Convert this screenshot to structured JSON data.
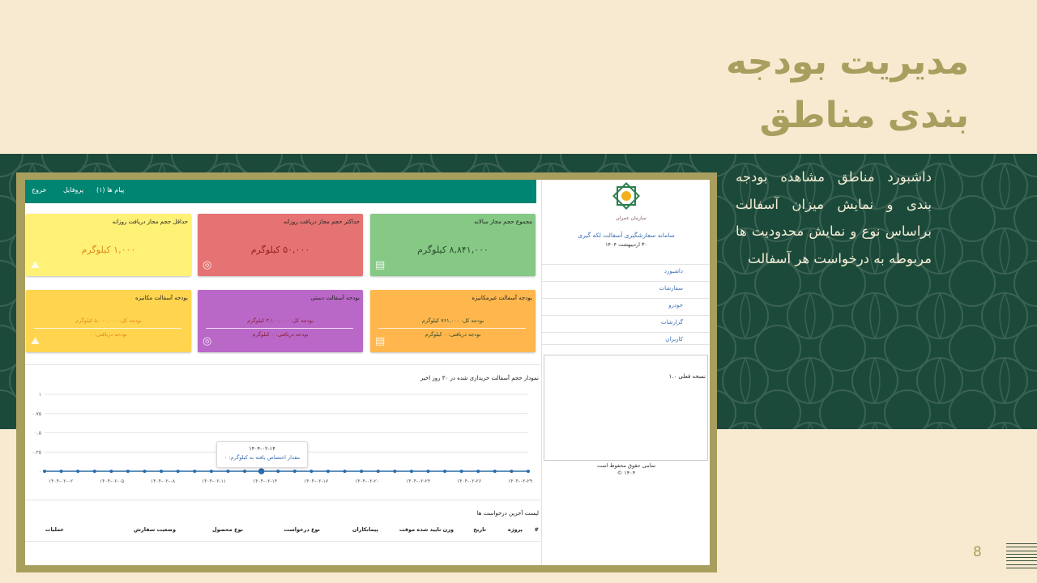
{
  "slide": {
    "title_line1": "مدیریت بودجه",
    "title_line2": "بندی مناطق",
    "description": "داشبورد مناطق مشاهده بودجه بندی و نمایش میزان آسفالت براساس نوع و نمایش محدودیت ها مربوطه به درخواست هر آسفالت",
    "page_number": "8",
    "colors": {
      "background": "#f7ead0",
      "band": "#1c4a3a",
      "title": "#a89e5e",
      "frame": "#a89e5e"
    }
  },
  "app": {
    "topbar": {
      "messages": "پیام ها (۱)",
      "profile": "پروفایل",
      "logout": "خروج",
      "color": "#008573"
    },
    "sidebar": {
      "logo_caption": "سازمان عمران",
      "system_name": "سامانه سفارشگیری آسفالت لکه گیری",
      "date": "۳۰ اردیبهشت ۱۴۰۴",
      "nav": [
        {
          "label": "داشبورد"
        },
        {
          "label": "سفارشات"
        },
        {
          "label": "خودرو"
        },
        {
          "label": "گزارشات"
        },
        {
          "label": "کاربران"
        }
      ],
      "version": "نسخه فعلی ۱.۰",
      "copyright": "تمامی حقوق محفوظ است",
      "copyright_year": "۱۴۰۴ ©"
    },
    "cards": [
      {
        "title": "مجموع حجم مجاز سالانه",
        "value": "۸,۸۴۱,۰۰۰ کیلوگرم",
        "color": "#85c985",
        "text_color": "#2e4a2e",
        "icon": "document-icon"
      },
      {
        "title": "حداکثر حجم مجاز دریافت روزانه",
        "value": "۵۰,۰۰۰ کیلوگرم",
        "color": "#e57373",
        "text_color": "#9a1f1f",
        "icon": "gauge-icon"
      },
      {
        "title": "حداقل حجم مجاز دریافت روزانه",
        "value": "۱,۰۰۰ کیلوگرم",
        "color": "#fff176",
        "text_color": "#e08a1e",
        "icon": "road-icon"
      },
      {
        "title": "بودجه آسفالت غیرمکانیزه",
        "line1": "بودجه کل: ۷۶۱,۰۰۰ کیلوگرم",
        "line2": "بودجه دریافتی: ۰ کیلوگرم",
        "color": "#ffb74d",
        "text_color": "#2e4a2e",
        "icon": "document-icon"
      },
      {
        "title": "بودجه آسفالت دستی",
        "line1": "بودجه کل: ۳,۱۰۰,۰۰۰ کیلوگرم",
        "line2": "بودجه دریافتی: ۰ کیلوگرم",
        "color": "#ba68c8",
        "text_color": "#8a1f3a",
        "icon": "gauge-icon"
      },
      {
        "title": "بودجه آسفالت مکانیزه",
        "line1": "بودجه کل: ۵,۰۰۰,۰۰۰ کیلوگرم",
        "line2": "بودجه دریافتی: ۰",
        "color": "#ffd54f",
        "text_color": "#e08a1e",
        "icon": "road-icon"
      }
    ],
    "table": {
      "title": "لیست آخرین درخواست ها",
      "headers": [
        "#",
        "پروژه",
        "تاریخ",
        "وزن تایید شده موقت",
        "پیمانکاران",
        "نوع درخواست",
        "نوع محصول",
        "وضعیت سفارش",
        "عملیات"
      ]
    },
    "tooltip": {
      "date": "۱۴۰۴-۰۲-۱۴",
      "label": "مقدار اختصاص یافته به کیلوگرم: ۰"
    }
  },
  "chart_data": {
    "type": "line",
    "title": "نمودار حجم آسفالت خریداری شده در ۳۰ روز اخیر",
    "ylim": [
      0,
      1
    ],
    "y_ticks": [
      "۰",
      "۰.۲۵",
      "۰.۵",
      "۰.۷۵",
      "۱"
    ],
    "x_tick_labels": [
      "۱۴۰۴-۰۲-۰۲",
      "۱۴۰۴-۰۲-۰۵",
      "۱۴۰۴-۰۲-۰۸",
      "۱۴۰۴-۰۲-۱۱",
      "۱۴۰۴-۰۲-۱۴",
      "۱۴۰۴-۰۲-۱۷",
      "۱۴۰۴-۰۲-۲۰",
      "۱۴۰۴-۰۲-۲۳",
      "۱۴۰۴-۰۲-۲۶",
      "۱۴۰۴-۰۲-۲۹"
    ],
    "x_range": [
      "۱۴۰۴-۰۲-۰۱",
      "۱۴۰۴-۰۳-۰۱"
    ],
    "values": [
      0,
      0,
      0,
      0,
      0,
      0,
      0,
      0,
      0,
      0,
      0,
      0,
      0,
      0,
      0,
      0,
      0,
      0,
      0,
      0,
      0,
      0,
      0,
      0,
      0,
      0,
      0,
      0,
      0,
      0
    ],
    "highlight_index": 13,
    "grid": true,
    "line_color": "#2a6ca8"
  }
}
